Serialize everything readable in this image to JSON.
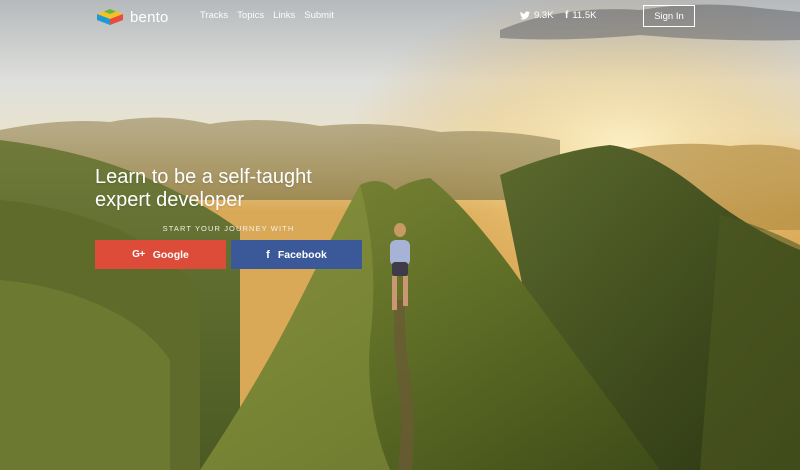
{
  "brand": {
    "name": "bento"
  },
  "nav": {
    "items": [
      "Tracks",
      "Topics",
      "Links",
      "Submit"
    ]
  },
  "social": {
    "twitter_count": "9.3K",
    "facebook_count": "11.5K"
  },
  "header": {
    "signin_label": "Sign In"
  },
  "hero": {
    "headline_line1": "Learn to be a self-taught",
    "headline_line2": "expert developer",
    "cta_label": "START YOUR JOURNEY WITH",
    "google_label": "Google",
    "facebook_label": "Facebook"
  },
  "colors": {
    "google": "#dd4b39",
    "facebook": "#3b5998",
    "text": "#ffffff"
  },
  "icons": {
    "google": "google-plus-icon",
    "facebook": "facebook-icon",
    "twitter": "twitter-icon",
    "logo": "bento-logo-icon"
  }
}
